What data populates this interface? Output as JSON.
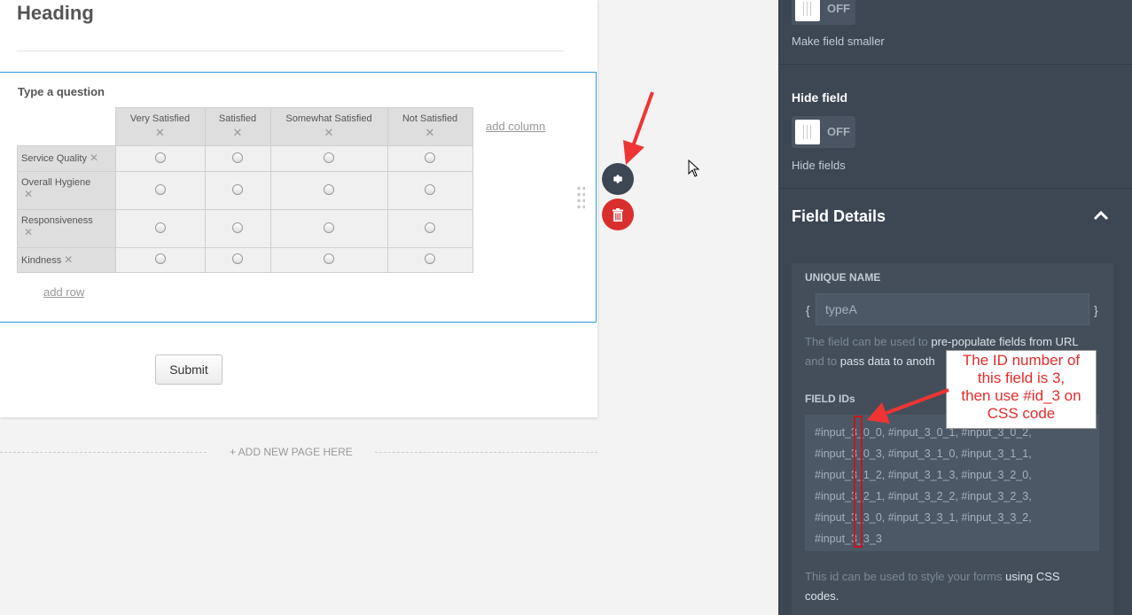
{
  "form": {
    "heading": "Heading",
    "question": "Type a question",
    "columns": [
      "Very Satisfied",
      "Satisfied",
      "Somewhat Satisfied",
      "Not Satisfied"
    ],
    "rows": [
      "Service Quality",
      "Overall Hygiene",
      "Responsiveness",
      "Kindness"
    ],
    "remove_glyph": "✕",
    "add_column": "add column",
    "add_row": "add row",
    "submit": "Submit",
    "add_page": "+ ADD NEW PAGE HERE"
  },
  "panel": {
    "toggle_state": "OFF",
    "make_smaller": "Make field smaller",
    "hide_field_title": "Hide field",
    "hide_fields": "Hide fields",
    "field_details": "Field Details",
    "unique_name_label": "UNIQUE NAME",
    "brace_open": "{",
    "brace_close": "}",
    "unique_name_value": "typeA",
    "help1_a": "The field can be used to ",
    "help1_b": "pre-populate fields from URL",
    "help1_c": "and to ",
    "help1_d": "pass data to anoth",
    "field_ids_label": "FIELD IDs",
    "field_ids": [
      "#input_3_0_0, #input_3_0_1, #input_3_0_2,",
      "#input_3_0_3, #input_3_1_0, #input_3_1_1,",
      "#input_3_1_2, #input_3_1_3, #input_3_2_0,",
      "#input_3_2_1, #input_3_2_2, #input_3_2_3,",
      "#input_3_3_0, #input_3_3_1, #input_3_3_2,",
      "#input_3_3_3"
    ],
    "help2_a": "This id can be used to style your forms ",
    "help2_b": "using CSS",
    "help2_c": "codes."
  },
  "annotation": {
    "lines": [
      "The ID number of",
      "this field is 3,",
      "then use #id_3 on",
      "CSS code"
    ]
  },
  "colors": {
    "accent": "#2b9be0",
    "panel_bg": "#3d4653",
    "delete_red": "#d9302f",
    "annotation_red": "#e52b2b"
  }
}
